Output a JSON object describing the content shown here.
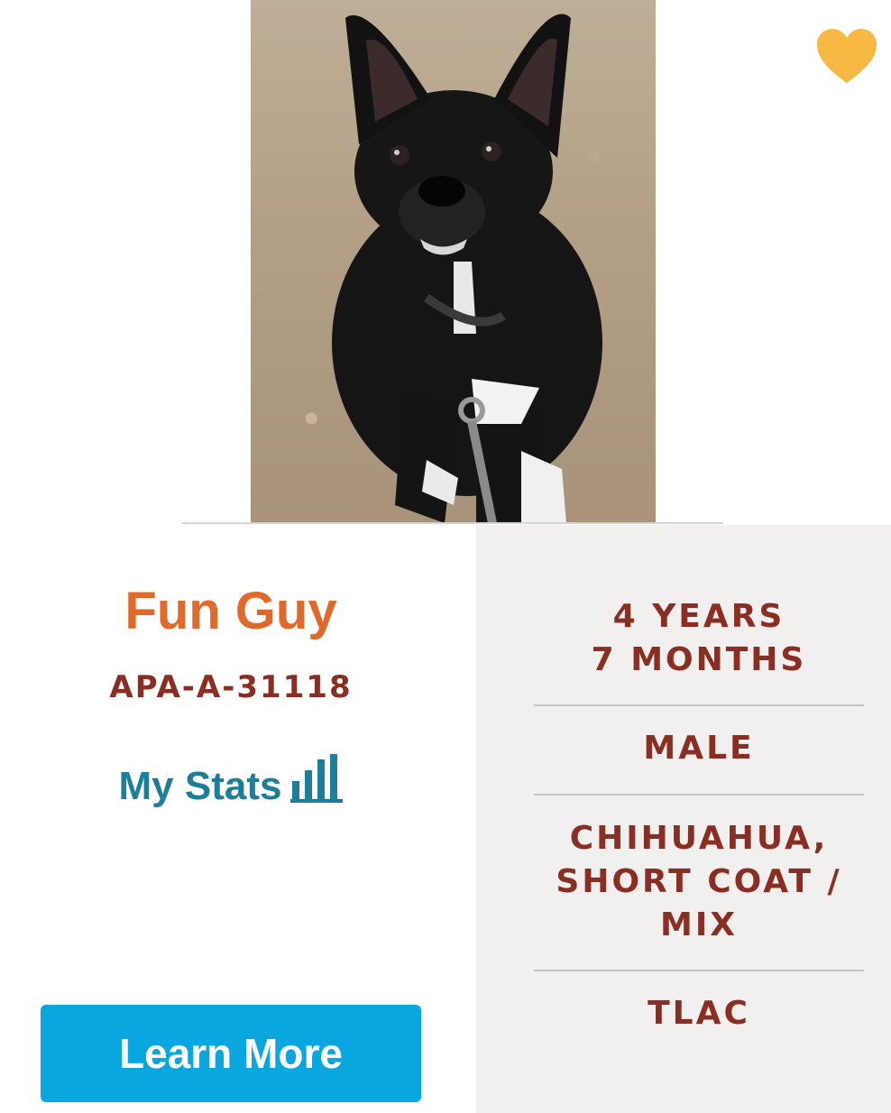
{
  "pet": {
    "name": "Fun Guy",
    "id": "APA-A-31118",
    "stats_label": "My Stats",
    "learn_more_label": "Learn More"
  },
  "icons": {
    "favorite": "heart-icon",
    "stats": "bar-chart-icon"
  },
  "attributes": {
    "age_line1": "4 YEARS",
    "age_line2": "7 MONTHS",
    "sex": "MALE",
    "breed_line1": "CHIHUAHUA,",
    "breed_line2": "SHORT COAT /",
    "breed_line3": "MIX",
    "location": "TLAC"
  },
  "colors": {
    "name": "#e06a2b",
    "id": "#8a2e23",
    "stats_link": "#1d7e9a",
    "button": "#0aa6df",
    "heart": "#f7b844",
    "attr_text": "#8a2e23",
    "attr_panel_bg": "#f2f0ef"
  }
}
